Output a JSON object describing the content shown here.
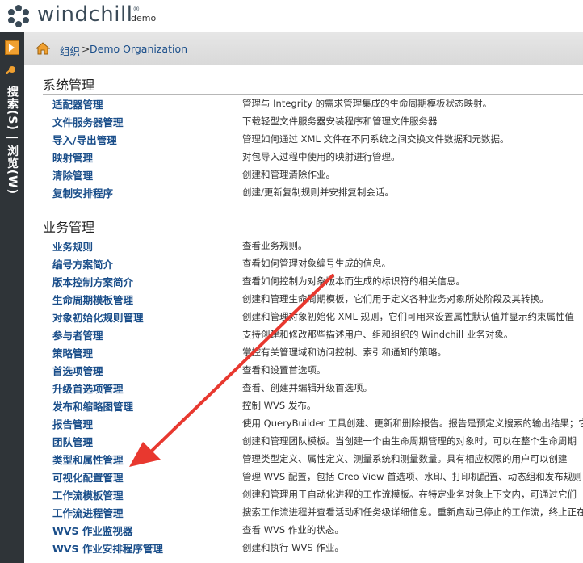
{
  "header": {
    "brand": "windchill",
    "trademark": "®",
    "org": "demo"
  },
  "nav": {
    "vertical_label": "搜索(S) | 浏览(W)"
  },
  "breadcrumb": {
    "items": [
      {
        "label": "组织"
      },
      {
        "label": "> "
      },
      {
        "label": "Demo Organization"
      }
    ]
  },
  "sections": [
    {
      "title": "系统管理",
      "rows": [
        {
          "name": "适配器管理",
          "desc": "管理与 Integrity 的需求管理集成的生命周期模板状态映射。"
        },
        {
          "name": "文件服务器管理",
          "desc": "下载轻型文件服务器安装程序和管理文件服务器"
        },
        {
          "name": "导入/导出管理",
          "desc": "管理如何通过 XML 文件在不同系统之间交换文件数据和元数据。"
        },
        {
          "name": "映射管理",
          "desc": "对包导入过程中使用的映射进行管理。"
        },
        {
          "name": "清除管理",
          "desc": "创建和管理清除作业。"
        },
        {
          "name": "复制安排程序",
          "desc": "创建/更新复制规则并安排复制会话。"
        }
      ]
    },
    {
      "title": "业务管理",
      "rows": [
        {
          "name": "业务规则",
          "desc": "查看业务规则。"
        },
        {
          "name": "编号方案简介",
          "desc": "查看如何管理对象编号生成的信息。"
        },
        {
          "name": "版本控制方案简介",
          "desc": "查看如何控制为对象版本而生成的标识符的相关信息。"
        },
        {
          "name": "生命周期模板管理",
          "desc": "创建和管理生命周期模板，它们用于定义各种业务对象所处阶段及其转换。"
        },
        {
          "name": "对象初始化规则管理",
          "desc": "创建和管理对象初始化 XML 规则，它们可用来设置属性默认值并显示约束属性值"
        },
        {
          "name": "参与者管理",
          "desc": "支持创建和修改那些描述用户、组和组织的 Windchill 业务对象。"
        },
        {
          "name": "策略管理",
          "desc": "掌控有关管理域和访问控制、索引和通知的策略。"
        },
        {
          "name": "首选项管理",
          "desc": "查看和设置首选项。"
        },
        {
          "name": "升级首选项管理",
          "desc": "查看、创建并编辑升级首选项。"
        },
        {
          "name": "发布和缩略图管理",
          "desc": "控制 WVS 发布。"
        },
        {
          "name": "报告管理",
          "desc": "使用 QueryBuilder 工具创建、更新和删除报告。报告是预定义搜索的输出结果；它"
        },
        {
          "name": "团队管理",
          "desc": "创建和管理团队模板。当创建一个由生命周期管理的对象时，可以在整个生命周期"
        },
        {
          "name": "类型和属性管理",
          "desc": "管理类型定义、属性定义、测量系统和测量数量。具有相应权限的用户可以创建"
        },
        {
          "name": "可视化配置管理",
          "desc": "管理 WVS 配置，包括 Creo View 首选项、水印、打印机配置、动态组和发布规则"
        },
        {
          "name": "工作流模板管理",
          "desc": "创建和管理用于自动化进程的工作流模板。在特定业务对象上下文内，可通过它们"
        },
        {
          "name": "工作流进程管理",
          "desc": "搜索工作流进程并查看活动和任务级详细信息。重新启动已停止的工作流，终止正在"
        },
        {
          "name": "WVS 作业监视器",
          "desc": "查看 WVS 作业的状态。"
        },
        {
          "name": "WVS 作业安排程序管理",
          "desc": "创建和执行 WVS 作业。"
        }
      ]
    }
  ],
  "colors": {
    "link": "#1a4e8a",
    "nav_bg": "#2f3438",
    "accent": "#f0a030",
    "arrow": "#e8382f"
  }
}
